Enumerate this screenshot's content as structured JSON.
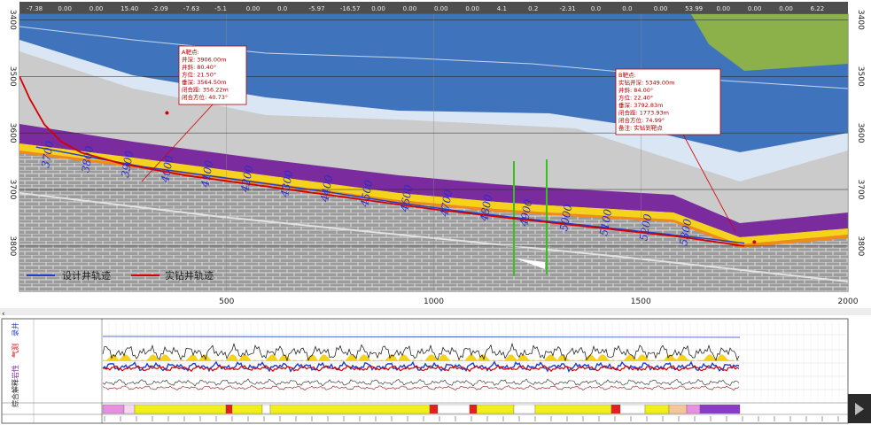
{
  "colors": {
    "top_band": "#4e4e4e",
    "green_layer": "#8cb14a",
    "blue_layer": "#3f74bd",
    "light_blue_layer": "#dbe6f4",
    "gray_layer": "#c9c9c9",
    "purple_layer": "#7a2c9e",
    "yellow_layer": "#f5d21c",
    "orange_layer": "#f08a1a",
    "brick_fill": "#9e9e9e",
    "brick_line": "#d8d8d8",
    "design_track": "#1f3fcc",
    "actual_track": "#d60000",
    "green_marker": "#35c21d"
  },
  "top_values": [
    "-7.38",
    "0.00",
    "0.00",
    "15.40",
    "-2.09",
    "-7.63",
    "-5.1",
    "0.00",
    "0.0",
    "-5.97",
    "-16.57",
    "0.00",
    "0.00",
    "0.00",
    "0.00",
    "4.1",
    "0.2",
    "-2.31",
    "0.0",
    "0.0",
    "0.00",
    "53.99",
    "0.00",
    "0.00",
    "0.00",
    "6.22"
  ],
  "depth_labels": [
    "3700",
    "3800",
    "3900",
    "4000",
    "4100",
    "4200",
    "4300",
    "4400",
    "4500",
    "4600",
    "4700",
    "4800",
    "4900",
    "5000",
    "5100",
    "5200",
    "5300"
  ],
  "annotation_left": {
    "lines": [
      "A靶点:",
      "井深: 3906.00m",
      "井斜: 80.40°",
      "方位: 21.50°",
      "垂深: 3564.50m",
      "闭合距: 356.22m",
      "闭合方位: 40.73°"
    ]
  },
  "annotation_right": {
    "lines": [
      "B靶点:",
      "实钻井深: 5349.00m",
      "井斜: 84.00°",
      "方位: 22.40°",
      "垂深: 3792.83m",
      "闭合距: 1773.93m",
      "闭合方位: 74.99°",
      "备注: 实钻到靶点"
    ]
  },
  "legend": {
    "design": "设计井轨迹",
    "actual": "实钻井轨迹"
  },
  "track_labels": [
    "录井",
    "气测",
    "岩性",
    "综合解释"
  ],
  "chart_data": {
    "type": "line",
    "xlim": [
      0,
      2000
    ],
    "ylim": [
      3880,
      3390
    ],
    "x_ticks": [
      500,
      1000,
      1500,
      2000
    ],
    "y_ticks_left": [
      3400,
      3500,
      3600,
      3700,
      3800
    ],
    "y_ticks_right": [
      3400,
      3500,
      3600,
      3700,
      3800
    ],
    "grid": true,
    "legend_position": "bottom-left",
    "series": [
      {
        "name": "设计井轨迹",
        "x": [
          40,
          150,
          300,
          450,
          600,
          750,
          900,
          1050,
          1200,
          1350,
          1500,
          1650,
          1750
        ],
        "y": [
          3625,
          3640,
          3660,
          3675,
          3690,
          3705,
          3722,
          3737,
          3750,
          3762,
          3774,
          3786,
          3795
        ]
      },
      {
        "name": "实钻井轨迹",
        "x": [
          0,
          25,
          60,
          100,
          150,
          250,
          400,
          600,
          800,
          1000,
          1200,
          1400,
          1600,
          1750
        ],
        "y": [
          3500,
          3540,
          3585,
          3615,
          3635,
          3655,
          3675,
          3695,
          3715,
          3735,
          3752,
          3768,
          3784,
          3800
        ]
      }
    ],
    "annotations": [
      {
        "x": 356,
        "y": 3564.5,
        "label": "A靶点"
      },
      {
        "x": 1774,
        "y": 3792.83,
        "label": "B靶点"
      }
    ]
  }
}
